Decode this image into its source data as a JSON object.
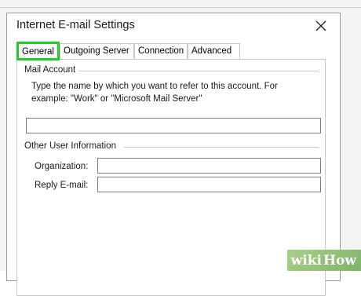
{
  "dialog": {
    "title": "Internet E-mail Settings",
    "close_icon": "close-icon"
  },
  "tabs": [
    {
      "label": "General",
      "active": true
    },
    {
      "label": "Outgoing Server",
      "active": false
    },
    {
      "label": "Connection",
      "active": false
    },
    {
      "label": "Advanced",
      "active": false
    }
  ],
  "mail_account": {
    "heading": "Mail Account",
    "description_line1": "Type the name by which you want to refer to this account. For",
    "description_line2": "example: \"Work\" or \"Microsoft Mail Server\"",
    "account_name_value": ""
  },
  "other_user_info": {
    "heading": "Other User Information",
    "organization_label": "Organization:",
    "organization_value": "",
    "reply_email_label": "Reply E-mail:",
    "reply_email_value": ""
  },
  "watermark": {
    "part1": "wiki",
    "part2": "How"
  },
  "colors": {
    "highlight": "#22cc22",
    "watermark_bg": "#8dbf74"
  }
}
